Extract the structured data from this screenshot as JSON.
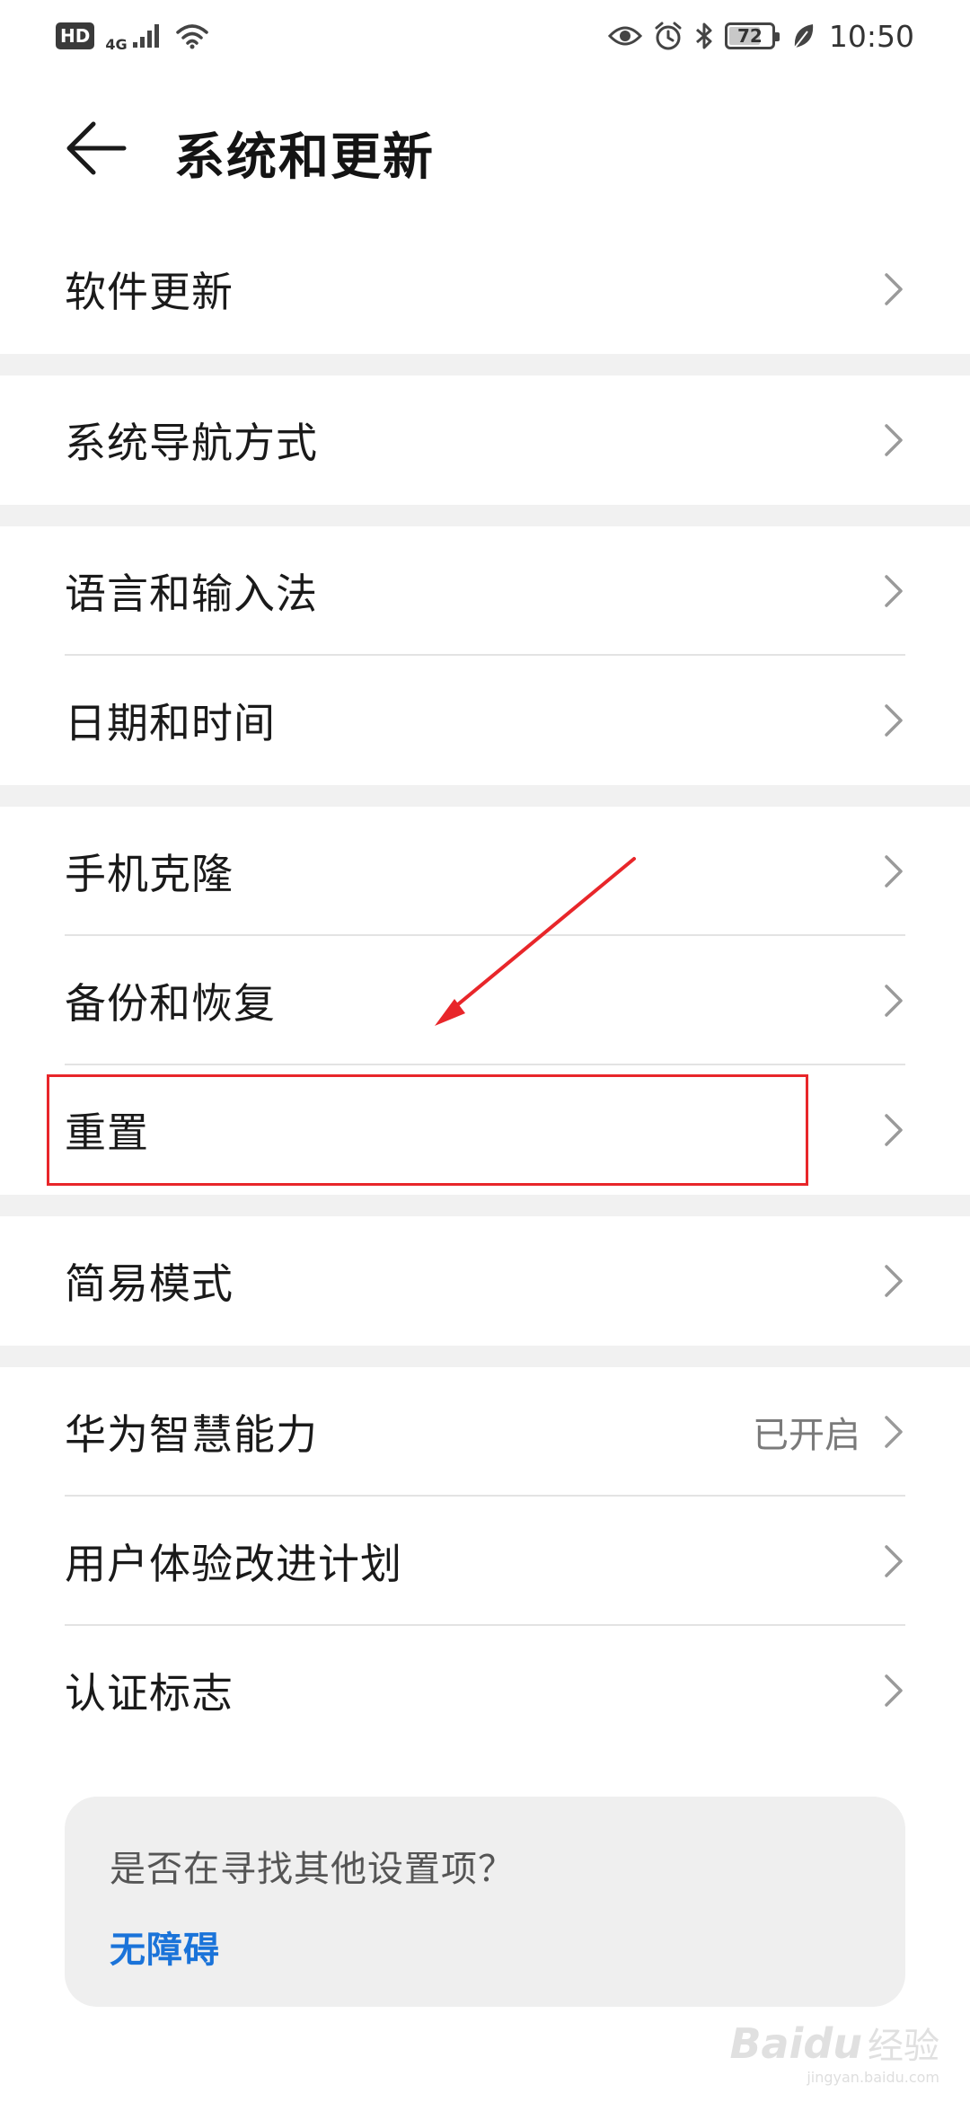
{
  "status_bar": {
    "hd_label": "HD",
    "network_label": "4G",
    "battery_level": "72",
    "time": "10:50"
  },
  "header": {
    "title": "系统和更新"
  },
  "sections": [
    {
      "items": [
        {
          "label": "软件更新"
        }
      ]
    },
    {
      "items": [
        {
          "label": "系统导航方式"
        }
      ]
    },
    {
      "items": [
        {
          "label": "语言和输入法"
        },
        {
          "label": "日期和时间"
        }
      ]
    },
    {
      "items": [
        {
          "label": "手机克隆"
        },
        {
          "label": "备份和恢复"
        },
        {
          "label": "重置"
        }
      ]
    },
    {
      "items": [
        {
          "label": "简易模式"
        }
      ]
    },
    {
      "items": [
        {
          "label": "华为智慧能力",
          "value": "已开启"
        },
        {
          "label": "用户体验改进计划"
        },
        {
          "label": "认证标志"
        }
      ]
    }
  ],
  "suggestion": {
    "question": "是否在寻找其他设置项？",
    "link": "无障碍"
  },
  "watermark": {
    "brand": "Baidu",
    "suffix": "经验",
    "url": "jingyan.baidu.com"
  },
  "colors": {
    "annotation_red": "#e8262a",
    "link_blue": "#1a73d9",
    "section_gap": "#f1f1f1",
    "card_bg": "#efefef"
  }
}
